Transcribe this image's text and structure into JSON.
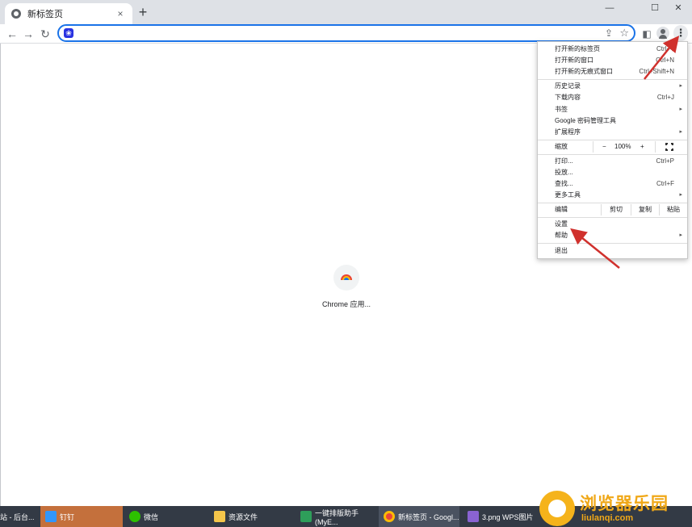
{
  "tab": {
    "title": "新标签页",
    "close": "×",
    "favicon": "chrome-icon"
  },
  "tabstrip": {
    "new_tab": "+",
    "minimize": "—",
    "maximize": "☐",
    "close": "✕"
  },
  "toolbar": {
    "back": "←",
    "forward": "→",
    "reload": "↻",
    "omnibox_value": "",
    "menu_icon": "⋮"
  },
  "shortcut": {
    "label": "Chrome 应用..."
  },
  "menu": {
    "new_tab": {
      "label": "打开新的标签页",
      "shortcut": "Ctrl+T"
    },
    "new_window": {
      "label": "打开新的窗口",
      "shortcut": "Ctrl+N"
    },
    "new_incognito": {
      "label": "打开新的无痕式窗口",
      "shortcut": "Ctrl+Shift+N"
    },
    "history": {
      "label": "历史记录"
    },
    "downloads": {
      "label": "下载内容",
      "shortcut": "Ctrl+J"
    },
    "bookmarks": {
      "label": "书签"
    },
    "passwords": {
      "label": "Google 密码管理工具"
    },
    "extensions": {
      "label": "扩展程序"
    },
    "zoom": {
      "label": "缩放",
      "minus": "−",
      "value": "100%",
      "plus": "+"
    },
    "print": {
      "label": "打印...",
      "shortcut": "Ctrl+P"
    },
    "cast": {
      "label": "投放..."
    },
    "find": {
      "label": "查找...",
      "shortcut": "Ctrl+F"
    },
    "more_tools": {
      "label": "更多工具"
    },
    "edit": {
      "label": "编辑",
      "cut": "剪切",
      "copy": "复制",
      "paste": "粘贴"
    },
    "settings": {
      "label": "设置"
    },
    "help": {
      "label": "帮助"
    },
    "exit": {
      "label": "退出"
    },
    "submenu_arrow": "▸"
  },
  "taskbar": {
    "items": [
      {
        "label": "站 - 后台..."
      },
      {
        "label": "钉钉"
      },
      {
        "label": "微信"
      },
      {
        "label": "资源文件"
      },
      {
        "label": "一键排版助手(MyE..."
      },
      {
        "label": "新标签页 - Googl..."
      },
      {
        "label": "3.png  WPS图片"
      }
    ]
  },
  "watermark": {
    "title": "浏览器乐园",
    "subtitle": "liulanqi.com"
  },
  "colors": {
    "accent": "#1a73e8",
    "arrow": "#d0312d",
    "taskbar": "#333a45",
    "watermark": "#f0a818"
  }
}
